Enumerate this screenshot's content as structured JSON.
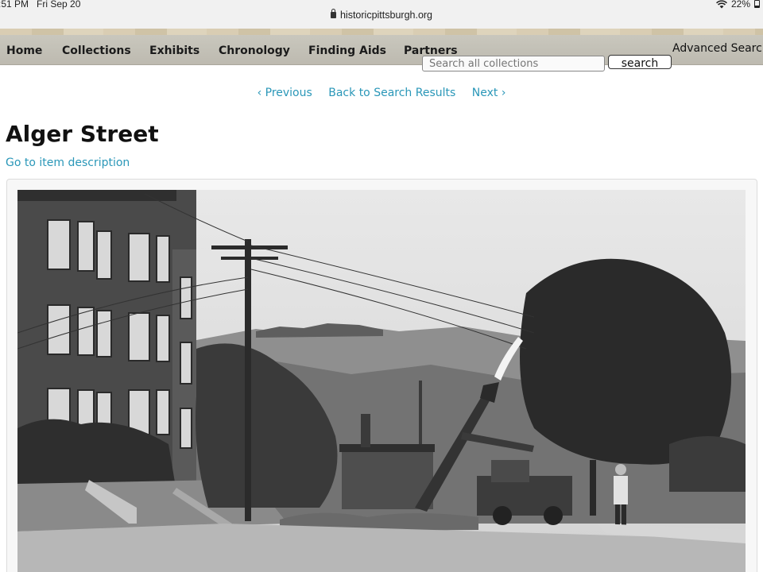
{
  "status_bar": {
    "time": ":51 PM",
    "date": "Fri Sep 20",
    "battery": "22%",
    "battery_level": 0.22,
    "icons": [
      "wifi-icon",
      "battery-icon"
    ]
  },
  "browser": {
    "url": "historicpittsburgh.org",
    "lock_icon": "lock-icon"
  },
  "nav": {
    "items": [
      "Home",
      "Collections",
      "Exhibits",
      "Chronology",
      "Finding Aids",
      "Partners"
    ],
    "search_placeholder": "Search all collections",
    "search_button": "search",
    "advanced_search": "Advanced Search"
  },
  "pager": {
    "previous": "‹ Previous",
    "back": "Back to Search Results",
    "next": "Next ›"
  },
  "item": {
    "title": "Alger Street",
    "description_link": "Go to item description"
  },
  "colors": {
    "link": "#2a97b8",
    "nav_bg": "#c4c2b7"
  }
}
